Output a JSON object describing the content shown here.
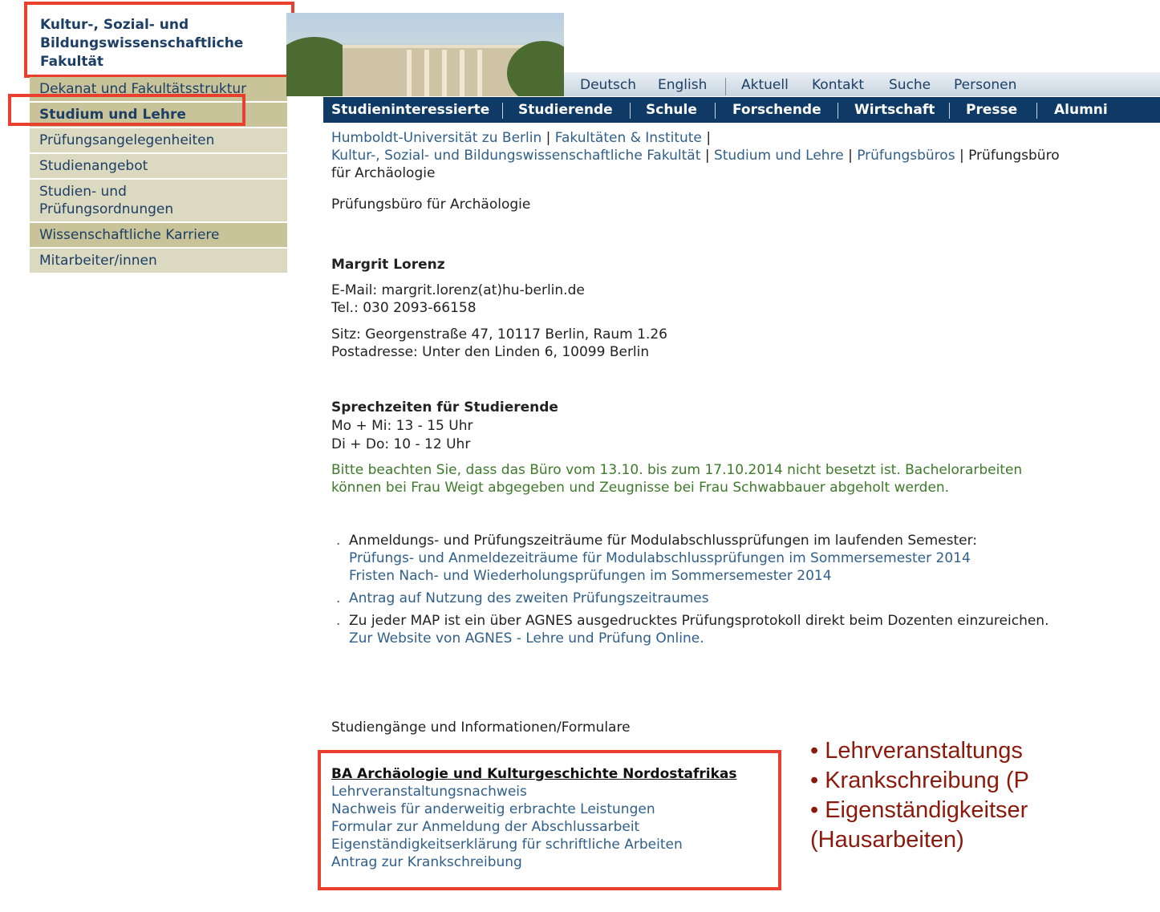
{
  "faculty": {
    "title_l1": "Kultur-, Sozial- und",
    "title_l2": "Bildungswissenschaftliche",
    "title_l3": "Fakultät"
  },
  "sidebar": {
    "items": [
      {
        "label": "Dekanat und Fakultätsstruktur"
      },
      {
        "label": "Studium und Lehre"
      },
      {
        "label": "Prüfungsangelegenheiten"
      },
      {
        "label": "Studienangebot"
      },
      {
        "label": "Studien- und"
      },
      {
        "label": "Prüfungsordnungen"
      },
      {
        "label": "Wissenschaftliche Karriere"
      },
      {
        "label": "Mitarbeiter/innen"
      }
    ]
  },
  "topnav": {
    "items": [
      "Deutsch",
      "English",
      "Aktuell",
      "Kontakt",
      "Suche",
      "Personen"
    ]
  },
  "mainnav": {
    "items": [
      "Studieninteressierte",
      "Studierende",
      "Schule",
      "Forschende",
      "Wirtschaft",
      "Presse",
      "Alumni"
    ]
  },
  "breadcrumb": {
    "b1": "Humboldt-Universität zu Berlin",
    "b2": "Fakultäten & Institute",
    "b3": "Kultur-, Sozial- und Bildungswissenschaftliche Fakultät",
    "b4": "Studium und Lehre",
    "b5": "Prüfungsbüros",
    "b6a": "Prüfungsbüro",
    "b6b": "für Archäologie",
    "sep": "|"
  },
  "page": {
    "title": "Prüfungsbüro für Archäologie"
  },
  "contact": {
    "name": "Margrit Lorenz",
    "email": "E-Mail: margrit.lorenz(at)hu-berlin.de",
    "phone": "Tel.: 030 2093-66158",
    "seat": "Sitz: Georgenstraße 47, 10117 Berlin, Raum 1.26",
    "postal": "Postadresse: Unter den Linden 6, 10099 Berlin"
  },
  "hours": {
    "heading": "Sprechzeiten für Studierende",
    "line1": "Mo + Mi: 13 - 15 Uhr",
    "line2": "Di + Do: 10 - 12 Uhr",
    "notice1": "Bitte beachten Sie, dass das Büro vom 13.10. bis zum 17.10.2014 nicht besetzt ist. Bachelorarbeiten",
    "notice2": "können bei Frau Weigt abgegeben und Zeugnisse bei Frau Schwabbauer abgeholt werden."
  },
  "bullets": {
    "b1_text": "Anmeldungs- und Prüfungszeiträume für Modulabschlussprüfungen im laufenden Semester:",
    "b1_link1": "Prüfungs- und Anmeldezeiträume für Modulabschlussprüfungen im Sommersemester 2014",
    "b1_link2": "Fristen Nach- und Wiederholungsprüfungen im Sommersemester 2014",
    "b2_link": "Antrag auf Nutzung des zweiten Prüfungszeitraumes",
    "b3_text": "Zu jeder MAP ist ein über AGNES ausgedrucktes Prüfungsprotokoll direkt beim Dozenten einzureichen.",
    "b3_link": "Zur Website von AGNES - Lehre und Prüfung Online."
  },
  "studies": {
    "heading": "Studiengänge und Informationen/Formulare",
    "program": "BA Archäologie und Kulturgeschichte Nordostafrikas",
    "links": [
      "Lehrveranstaltungsnachweis",
      "Nachweis für anderweitig erbrachte Leistungen",
      "Formular zur Anmeldung der Abschlussarbeit",
      "Eigenständigkeitserklärung für schriftliche Arbeiten",
      "Antrag zur Krankschreibung"
    ]
  },
  "overlay": {
    "line1": "• Lehrveranstaltungs",
    "line2": "• Krankschreibung (P",
    "line3": "• Eigenständigkeitser",
    "line4": "(Hausarbeiten)"
  },
  "colors": {
    "nav_blue": "#0f3a66",
    "highlight_red": "#e8402c",
    "link_blue": "#2f5f8a",
    "notice_green": "#3d7a2a",
    "overlay_red": "#8b1a0c"
  }
}
